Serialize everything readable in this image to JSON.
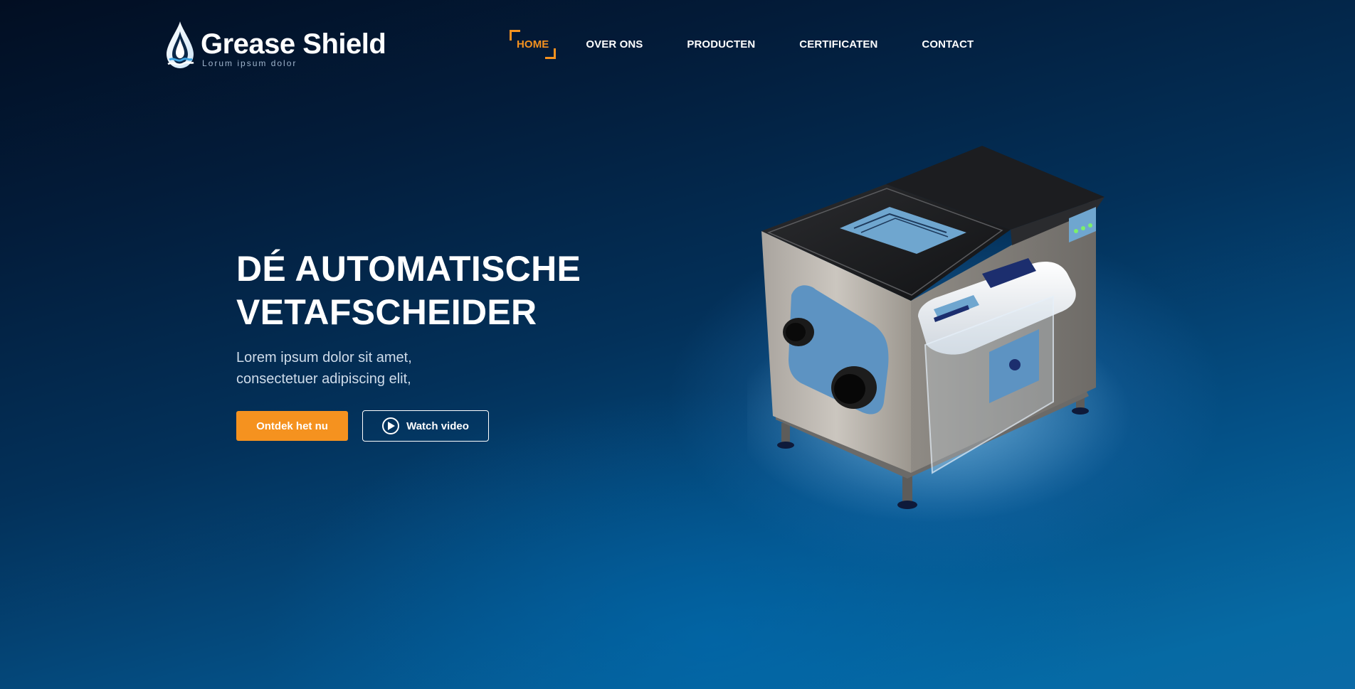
{
  "brand": {
    "name": "Grease Shield",
    "tagline": "Lorum ipsum dolor"
  },
  "nav": {
    "items": [
      {
        "label": "HOME",
        "active": true
      },
      {
        "label": "OVER ONS",
        "active": false
      },
      {
        "label": "PRODUCTEN",
        "active": false
      },
      {
        "label": "CERTIFICATEN",
        "active": false
      },
      {
        "label": "CONTACT",
        "active": false
      }
    ]
  },
  "hero": {
    "title_line1": "DÉ AUTOMATISCHE",
    "title_line2": "VETAFSCHEIDER",
    "subtitle_line1": "Lorem ipsum dolor sit amet,",
    "subtitle_line2": "consectetuer adipiscing elit,",
    "primary_button": "Ontdek het nu",
    "video_button": "Watch video"
  },
  "colors": {
    "accent": "#f5921f",
    "background_top": "#020e22",
    "background_bottom": "#066aa4",
    "text": "#ffffff"
  },
  "icons": {
    "logo": "water-drop-icon",
    "video": "play-circle-icon"
  }
}
